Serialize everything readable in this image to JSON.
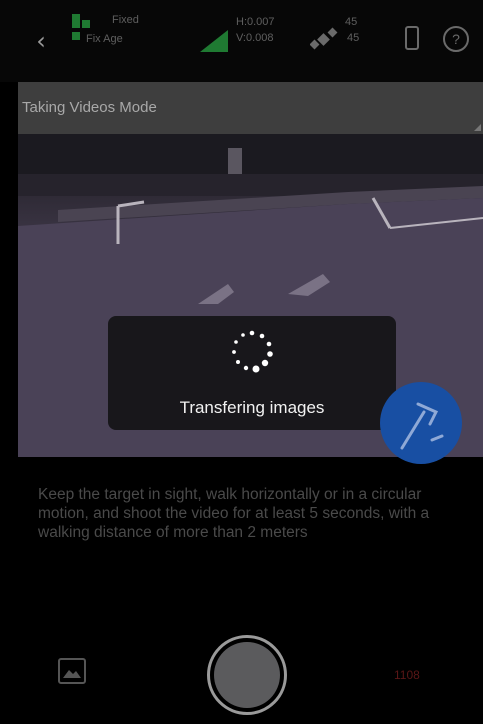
{
  "status_bar": {
    "back_icon": "chevron-left-icon",
    "fix_label": "Fixed",
    "fix_age": "Fix Age",
    "rtk_line1": "H:0.007",
    "rtk_line2": "V:0.008",
    "sat_line1": "45",
    "sat_line2": "45",
    "icons": [
      "gps-fix-icon",
      "rtk-signal-icon",
      "satellite-icon",
      "battery-icon",
      "help-icon"
    ],
    "green": "#1f7a32"
  },
  "mode": {
    "label": "Taking Videos Mode"
  },
  "dialog": {
    "message": "Transfering images",
    "icon": "loading-spinner-icon"
  },
  "instruction": {
    "text": "Keep the target in sight, walk horizontally or in a circular motion, and shoot the video for at least 5 seconds, with a walking distance of more than 2 meters"
  },
  "bottom": {
    "gallery_icon": "gallery-icon",
    "shutter": "shutter-button",
    "timer": "1108"
  },
  "colors": {
    "accent_blue": "#184fa3",
    "timer_red": "#5a1616"
  }
}
